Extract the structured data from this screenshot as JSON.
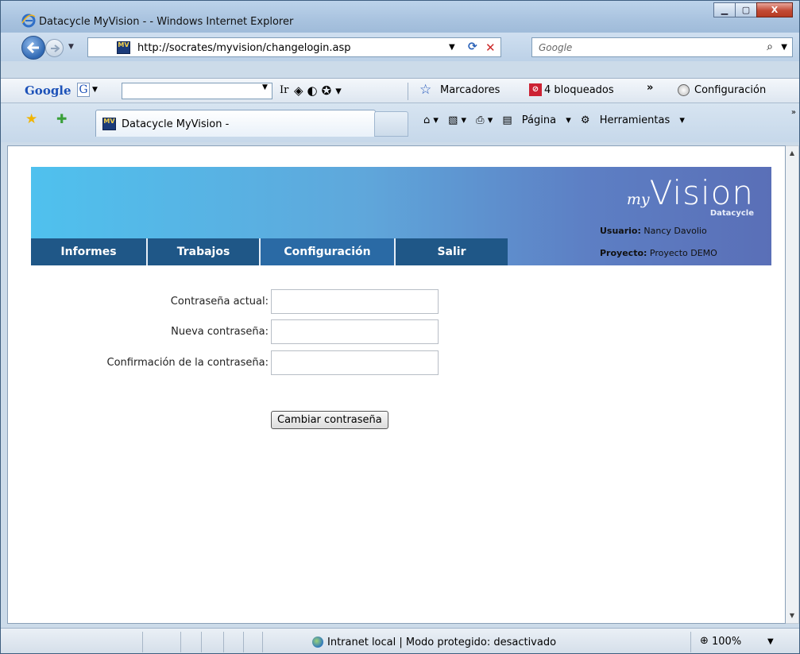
{
  "window": {
    "title": "Datacycle MyVision - - Windows Internet Explorer",
    "controls": {
      "minimize": "▁",
      "maximize": "▢",
      "close": "X"
    }
  },
  "address_bar": {
    "url": "http://socrates/myvision/changelogin.asp",
    "site_icon_text": "MV",
    "search_placeholder": "Google"
  },
  "google_toolbar": {
    "logo": "Google",
    "g_button": "G",
    "go_label": "Ir",
    "bookmarks_label": "Marcadores",
    "blocked_label": "4 bloqueados",
    "more_label": "»",
    "settings_label": "Configuración"
  },
  "tabs": [
    {
      "title": "Datacycle MyVision -",
      "icon_text": "MV"
    }
  ],
  "command_bar": {
    "page_label": "Página",
    "tools_label": "Herramientas"
  },
  "app": {
    "logo_my": "my",
    "logo_vision": "Vision",
    "logo_sub": "Datacycle",
    "user_label": "Usuario:",
    "user_value": "Nancy Davolio",
    "project_label": "Proyecto:",
    "project_value": "Proyecto DEMO",
    "nav": [
      {
        "label": "Informes"
      },
      {
        "label": "Trabajos"
      },
      {
        "label": "Configuración"
      },
      {
        "label": "Salir"
      }
    ]
  },
  "form": {
    "current_password_label": "Contraseña actual:",
    "current_password_value": "",
    "new_password_label": "Nueva contraseña:",
    "new_password_value": "",
    "confirm_password_label": "Confirmación de la contraseña:",
    "confirm_password_value": "",
    "submit_label": "Cambiar contraseña"
  },
  "status_bar": {
    "zone_text": "Intranet local | Modo protegido: desactivado",
    "zoom": "100%"
  },
  "colors": {
    "nav_bg": "#1f5787",
    "header_gradient_start": "#4fc1ee",
    "header_gradient_end": "#5a6fb7"
  }
}
